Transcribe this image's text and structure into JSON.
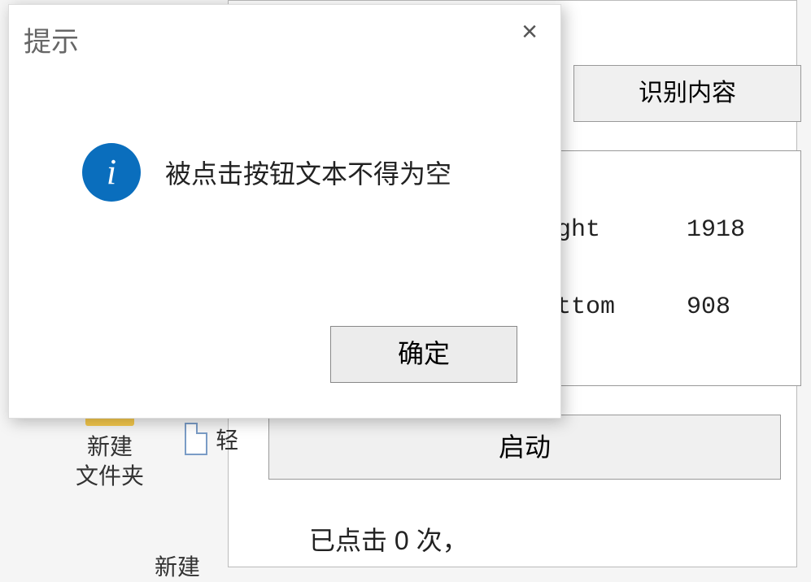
{
  "dialog": {
    "title": "提示",
    "message": "被点击按钮文本不得为空",
    "ok_label": "确定",
    "close_glyph": "×",
    "info_glyph": "i"
  },
  "main": {
    "recognize_btn_label": "识别内容",
    "panel": {
      "right_label": "ight",
      "right_value": "1918",
      "bottom_label": "ottom",
      "bottom_value": "908"
    },
    "start_btn_label": "启动",
    "status_text": "已点击 0 次，"
  },
  "desktop": {
    "folder_label": "新建\n文件夹",
    "file_label_prefix": "轻",
    "new_partial": "新建"
  }
}
